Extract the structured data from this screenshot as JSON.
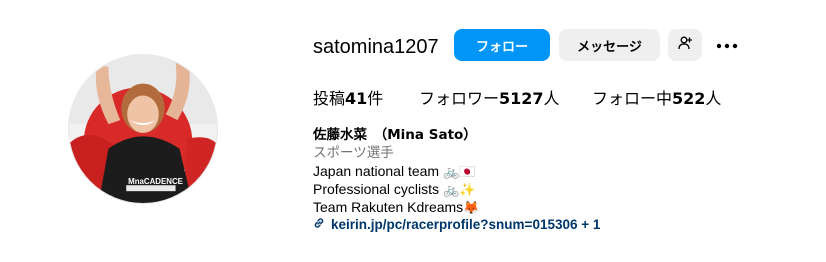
{
  "profile": {
    "username": "satomina1207",
    "follow_label": "フォロー",
    "message_label": "メッセージ",
    "suggest_icon": "person-add-icon",
    "more_icon": "more-options-icon"
  },
  "stats": {
    "posts_label": "投稿",
    "posts_count": "41",
    "posts_unit": "件",
    "followers_label": "フォロワー",
    "followers_count": "5127",
    "followers_unit": "人",
    "following_label": "フォロー中",
    "following_count": "522",
    "following_unit": "人"
  },
  "bio": {
    "full_name": "佐藤水菜　（Mina Sato）",
    "category": "スポーツ選手",
    "line1": "Japan national team",
    "line1_emoji": "🚲🇯🇵",
    "line2": "Professional cyclists",
    "line2_emoji": "🚲✨",
    "line3": "Team Rakuten Kdreams",
    "line3_emoji": "🦊",
    "link": "keirin.jp/pc/racerprofile?snum=015306 + 1",
    "link_icon": "link-icon"
  },
  "colors": {
    "follow_button": "#0095f6",
    "secondary_button": "#efefef",
    "link_text": "#00376b",
    "category_text": "#737373"
  }
}
